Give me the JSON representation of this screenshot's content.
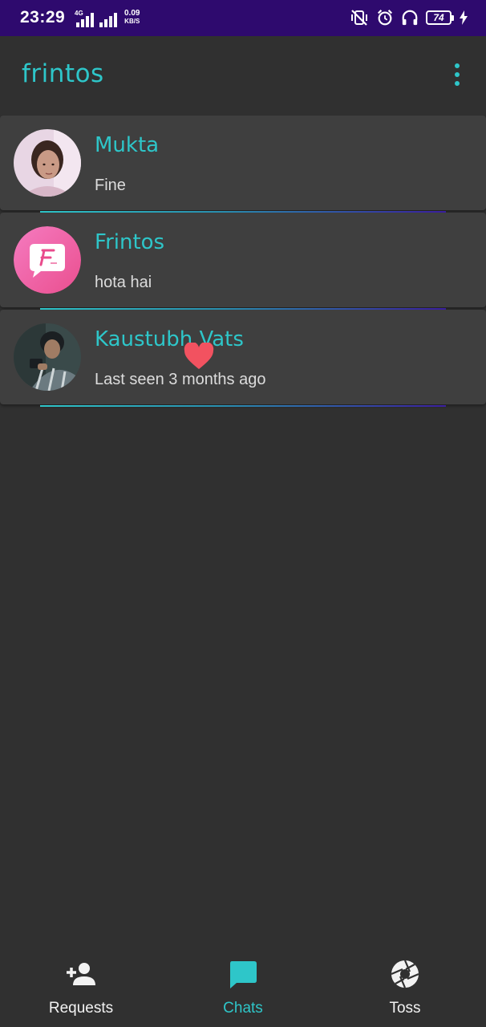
{
  "status_bar": {
    "time": "23:29",
    "network": "4G",
    "speed_value": "0.09",
    "speed_unit": "KB/S",
    "battery": "74",
    "icons": [
      "vibrate-off-icon",
      "alarm-icon",
      "headphones-icon",
      "battery-icon",
      "charging-icon"
    ]
  },
  "app_bar": {
    "title": "frintos",
    "menu_icon": "more-vert-icon"
  },
  "chats": [
    {
      "name": "Mukta",
      "message": "Fine",
      "avatar": "photo-girl"
    },
    {
      "name": "Frintos",
      "message": "hota hai",
      "avatar": "frintos-logo",
      "badge": "heart-icon"
    },
    {
      "name": "Kaustubh Vats",
      "message": "Last seen 3 months ago",
      "avatar": "photo-boy"
    }
  ],
  "bottom_nav": {
    "items": [
      {
        "label": "Requests",
        "icon": "person-add-icon",
        "active": false
      },
      {
        "label": "Chats",
        "icon": "chat-bubble-icon",
        "active": true
      },
      {
        "label": "Toss",
        "icon": "camera-aperture-icon",
        "active": false
      }
    ]
  },
  "colors": {
    "accent": "#2ec6c9",
    "status_bar": "#2e0a6e",
    "background": "#303030",
    "card": "#3f3f3f",
    "heart": "#f25260",
    "logo_pink": "#ef5fa0"
  }
}
